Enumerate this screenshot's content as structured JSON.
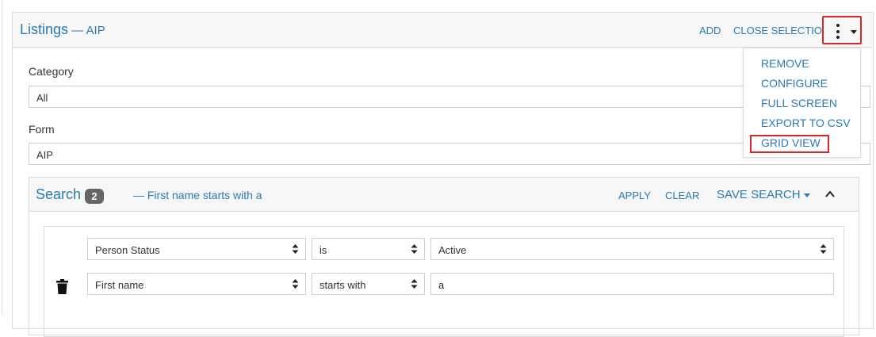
{
  "panel": {
    "title": "Listings",
    "title_suffix": " — AIP",
    "actions": {
      "add": "ADD",
      "close_selection": "CLOSE SELECTION"
    },
    "menu_items": [
      "REMOVE",
      "CONFIGURE",
      "FULL SCREEN",
      "EXPORT TO CSV",
      "GRID VIEW"
    ]
  },
  "filters": {
    "category_label": "Category",
    "category_value": "All",
    "form_label": "Form",
    "form_value": "AIP"
  },
  "search": {
    "title": "Search",
    "count": "2",
    "description": "— First name starts with a",
    "apply": "APPLY",
    "clear": "CLEAR",
    "save_search": "SAVE SEARCH",
    "criteria": [
      {
        "field": "Person Status",
        "operator": "is",
        "value": "Active"
      },
      {
        "field": "First name",
        "operator": "starts with",
        "value": "a"
      }
    ]
  },
  "colors": {
    "link": "#2a7ab5",
    "highlight": "#d9262b",
    "header_bg": "#f7f7f7",
    "badge": "#666666"
  }
}
